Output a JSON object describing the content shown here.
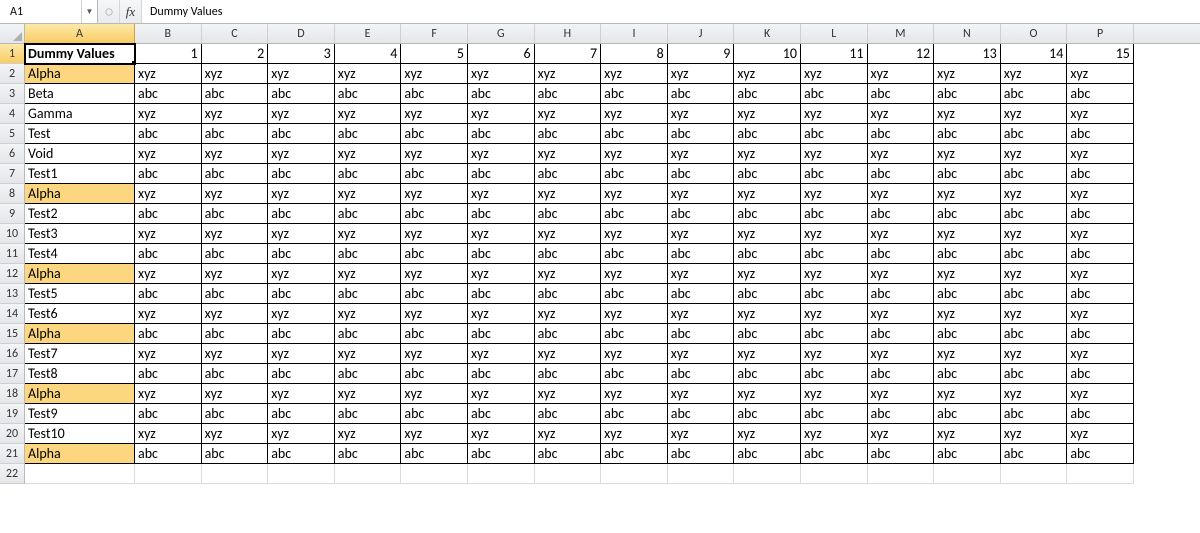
{
  "formula_bar": {
    "name_box": "A1",
    "fx_label": "fx",
    "formula_value": "Dummy Values"
  },
  "columns": [
    "A",
    "B",
    "C",
    "D",
    "E",
    "F",
    "G",
    "H",
    "I",
    "J",
    "K",
    "L",
    "M",
    "N",
    "O",
    "P"
  ],
  "col_nums": [
    "1",
    "2",
    "3",
    "4",
    "5",
    "6",
    "7",
    "8",
    "9",
    "10",
    "11",
    "12",
    "13",
    "14",
    "15"
  ],
  "header_label": "Dummy Values",
  "row_labels": [
    "Alpha",
    "Beta",
    "Gamma",
    "Test",
    "Void",
    "Test1",
    "Alpha",
    "Test2",
    "Test3",
    "Test4",
    "Alpha",
    "Test5",
    "Test6",
    "Alpha",
    "Test7",
    "Test8",
    "Alpha",
    "Test9",
    "Test10",
    "Alpha"
  ],
  "pattern_values": [
    "xyz",
    "abc"
  ],
  "highlight_rows": [
    2,
    8,
    12,
    15,
    18,
    21
  ],
  "selected_cell": "A1",
  "row_count": 22
}
